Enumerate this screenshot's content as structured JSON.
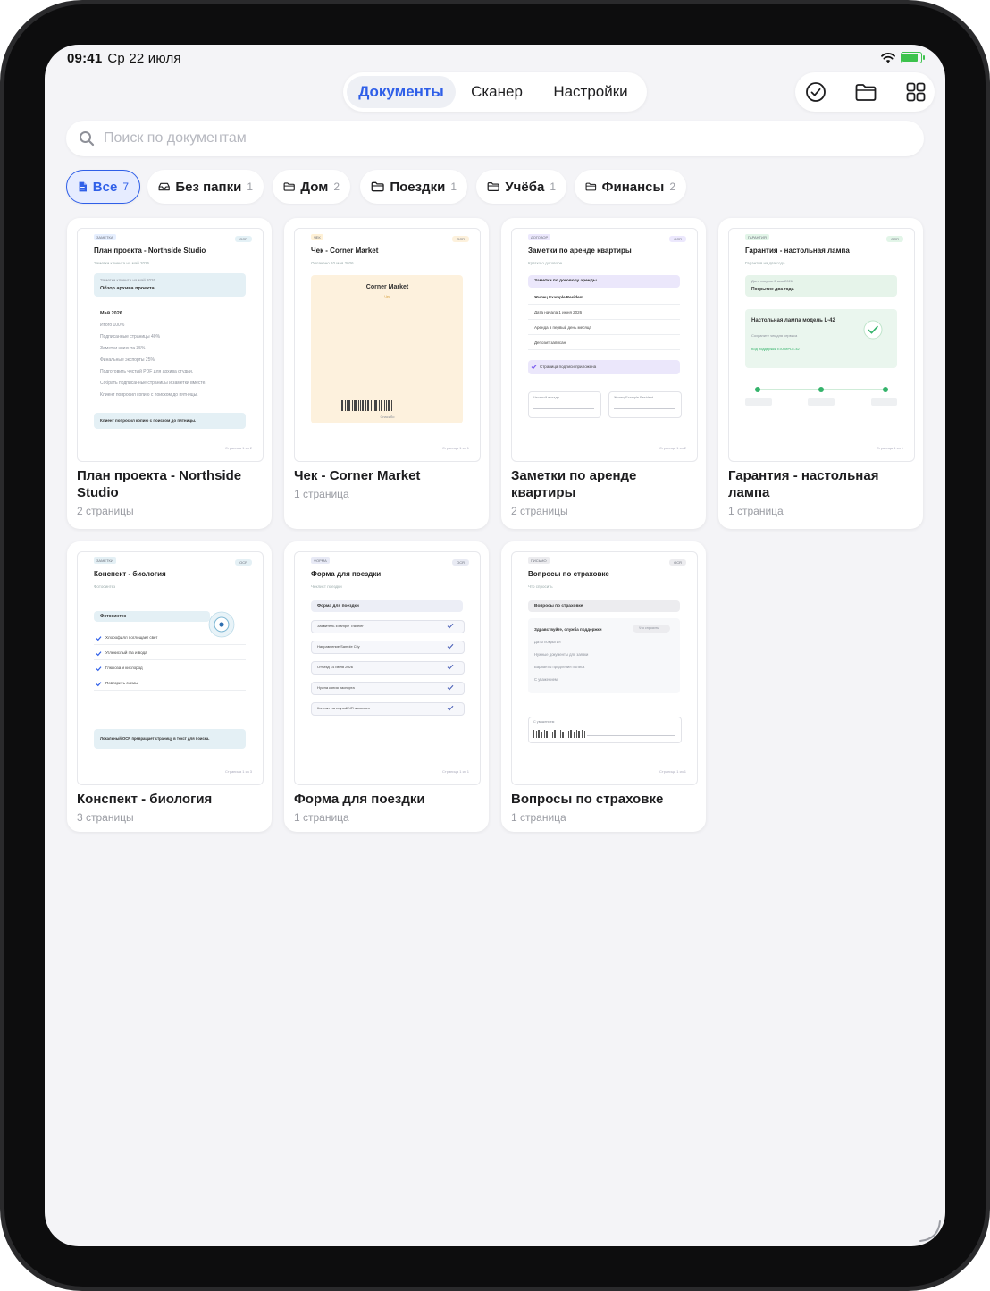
{
  "status_bar": {
    "time": "09:41",
    "date": "Ср 22 июля"
  },
  "tabs": [
    {
      "label": "Документы",
      "active": true
    },
    {
      "label": "Сканер",
      "active": false
    },
    {
      "label": "Настройки",
      "active": false
    }
  ],
  "toolbar_icons": [
    "checkmark-circle-icon",
    "folder-icon",
    "grid-icon"
  ],
  "search": {
    "placeholder": "Поиск по документам"
  },
  "filters": [
    {
      "label": "Все",
      "count": "7",
      "icon": "document-icon",
      "active": true
    },
    {
      "label": "Без папки",
      "count": "1",
      "icon": "tray-icon"
    },
    {
      "label": "Дом",
      "count": "2",
      "icon": "folder-icon"
    },
    {
      "label": "Поездки",
      "count": "1",
      "icon": "folder-icon"
    },
    {
      "label": "Учёба",
      "count": "1",
      "icon": "folder-icon"
    },
    {
      "label": "Финансы",
      "count": "2",
      "icon": "folder-icon"
    }
  ],
  "colors": {
    "accent": "#2f5fe8",
    "background": "#f4f4f7",
    "success": "#34b36b"
  },
  "documents": [
    {
      "title": "План проекта - Northside Studio",
      "pages": "2 страницы",
      "thumb": {
        "tag": "ЗАМЕТКА",
        "badge": "OCR",
        "title": "План проекта - Northside Studio",
        "meta": "Заметки клиента на май 2026",
        "box_line1": "Заметки клиента на май 2026",
        "box_line2": "Обзор архива проекта",
        "section": "Май 2026",
        "lines": [
          "Итого 100%",
          "Подписанные страницы 40%",
          "Заметки клиента 35%",
          "Финальные экспорты 25%",
          "Подготовить чистый PDF для архива студии.",
          "Собрать подписанные страницы и заметки вместе.",
          "Клиент попросил копию с поиском до пятницы."
        ],
        "callout": "Клиент попросил копию с поиском до пятницы.",
        "footer": "Страница 1 из 2"
      }
    },
    {
      "title": "Чек - Corner Market",
      "pages": "1 страница",
      "thumb": {
        "tag": "ЧЕК",
        "badge": "OCR",
        "title": "Чек - Corner Market",
        "meta": "Оплачено 10 мая 2026",
        "receipt_title": "Corner Market",
        "receipt_sub": "Чек",
        "receipt_footer": "Спасибо",
        "footer": "Страница 1 из 1"
      }
    },
    {
      "title": "Заметки по аренде квартиры",
      "pages": "2 страницы",
      "thumb": {
        "tag": "ДОГОВОР",
        "badge": "OCR",
        "title": "Заметки по аренде квартиры",
        "meta": "Кратко о договоре",
        "header": "Заметки по договору аренды",
        "lines": [
          "Жилец Example Resident",
          "Дата начала 1 июня 2026",
          "Аренда в первый день месяца",
          "Депозит записан"
        ],
        "check": "Страница подписи приложена",
        "sig_left": "Честный вклады",
        "sig_right": "Жилец Example Resident",
        "footer": "Страница 1 из 2"
      }
    },
    {
      "title": "Гарантия - настольная лампа",
      "pages": "1 страница",
      "thumb": {
        "tag": "ГАРАНТИЯ",
        "badge": "OCR",
        "title": "Гарантия - настольная лампа",
        "meta": "Гарантия на два года",
        "box_line1": "Дата покупки 2 мая 2026",
        "box_line2": "Покрытие два года",
        "product": "Настольная лампа модель L-42",
        "product_sub": "Сохраните чек для сервиса",
        "product_code": "Код поддержки EXAMPLE-42",
        "footer": "Страница 1 из 1"
      }
    },
    {
      "title": "Конспект - биология",
      "pages": "3 страницы",
      "thumb": {
        "tag": "ЗАМЕТКИ",
        "badge": "OCR",
        "title": "Конспект - биология",
        "meta": "Фотосинтез",
        "section": "Фотосинтез",
        "checks": [
          "Хлорофилл поглощает свет",
          "Углекислый газ и вода",
          "Глюкоза и кислород",
          "Повторить схемы"
        ],
        "callout": "Локальный OCR превращает страницу в текст для поиска.",
        "footer": "Страница 1 из 3"
      }
    },
    {
      "title": "Форма для поездки",
      "pages": "1 страница",
      "thumb": {
        "tag": "ФОРМА",
        "badge": "OCR",
        "title": "Форма для поездки",
        "meta": "Чеклист поездки",
        "header": "Форма для поездки",
        "rows": [
          "Заявитель Example Traveler",
          "Направление Sample City",
          "Отъезд 14 июля 2026",
          "Нужна копия паспорта",
          "Контакт на случай ЧП заполнен"
        ],
        "footer": "Страница 1 из 1"
      }
    },
    {
      "title": "Вопросы по страховке",
      "pages": "1 страница",
      "thumb": {
        "tag": "ПИСЬМО",
        "badge": "OCR",
        "title": "Вопросы по страховке",
        "meta": "Что спросить",
        "header": "Вопросы по страховке",
        "greeting": "Здравствуйте, служба поддержки",
        "pill": "Что спросить",
        "lines": [
          "Даты покрытия",
          "Нужные документы для заявки",
          "Варианты продления полиса",
          "С уважением"
        ],
        "sig_label": "С уважением",
        "footer": "Страница 1 из 1"
      }
    }
  ]
}
